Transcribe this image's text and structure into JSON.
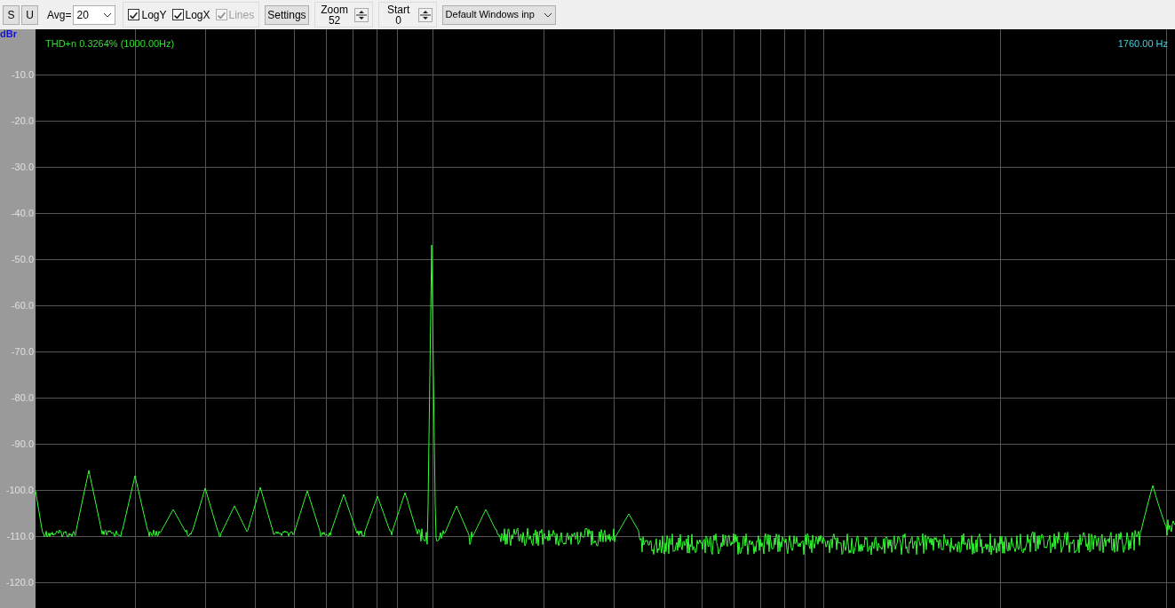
{
  "toolbar": {
    "buttons": [
      "S",
      "U"
    ],
    "avg": {
      "label": "Avg=",
      "value": "20"
    },
    "checkboxes": [
      {
        "label": "LogY",
        "checked": true,
        "disabled": false
      },
      {
        "label": "LogX",
        "checked": true,
        "disabled": false
      },
      {
        "label": "Lines",
        "checked": true,
        "disabled": true
      }
    ],
    "settings_button": "Settings",
    "spinners": [
      {
        "label": "Zoom",
        "value": "52"
      },
      {
        "label": "Start",
        "value": "0"
      }
    ],
    "device": "Default Windows inp"
  },
  "plot": {
    "unit": "dBr",
    "y_labels": [
      "-10.0",
      "-20.0",
      "-30.0",
      "-40.0",
      "-50.0",
      "-60.0",
      "-70.0",
      "-80.0",
      "-90.0",
      "-100.0",
      "-110.0",
      "-120.0"
    ],
    "thd_readout": "THD+n 0.3264% (1000.00Hz)",
    "cursor_readout": "1760.00 Hz"
  }
}
